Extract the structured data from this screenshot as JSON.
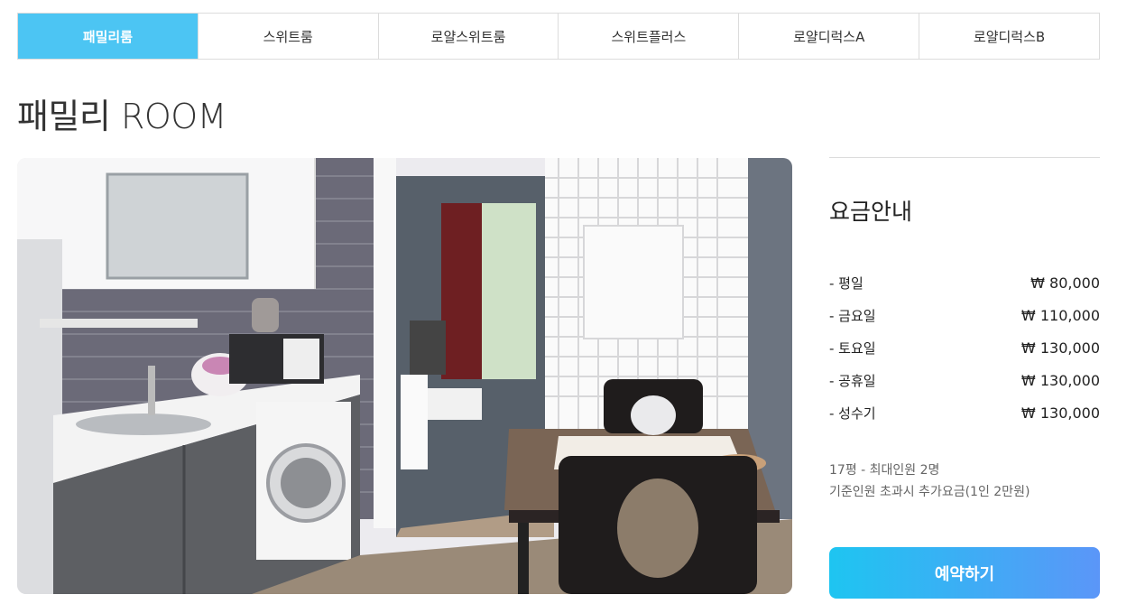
{
  "tabs": [
    {
      "label": "패밀리룸",
      "active": true
    },
    {
      "label": "스위트룸",
      "active": false
    },
    {
      "label": "로얄스위트룸",
      "active": false
    },
    {
      "label": "스위트플러스",
      "active": false
    },
    {
      "label": "로얄디럭스A",
      "active": false
    },
    {
      "label": "로얄디럭스B",
      "active": false
    }
  ],
  "room": {
    "title": "패밀리 ROOM"
  },
  "pricing": {
    "title": "요금안내",
    "rows": [
      {
        "label": "- 평일",
        "price": "₩ 80,000"
      },
      {
        "label": "- 금요일",
        "price": "₩ 110,000"
      },
      {
        "label": "- 토요일",
        "price": "₩ 130,000"
      },
      {
        "label": "- 공휴일",
        "price": "₩ 130,000"
      },
      {
        "label": "- 성수기",
        "price": "₩ 130,000"
      }
    ],
    "notes": [
      "17평 - 최대인원 2명",
      "기준인원 초과시 추가요금(1인 2만원)"
    ]
  },
  "reserve_button": {
    "label": "예약하기"
  },
  "colors": {
    "accent": "#4cc5f3",
    "button_start": "#1ec5f1",
    "button_end": "#5b96f8"
  }
}
